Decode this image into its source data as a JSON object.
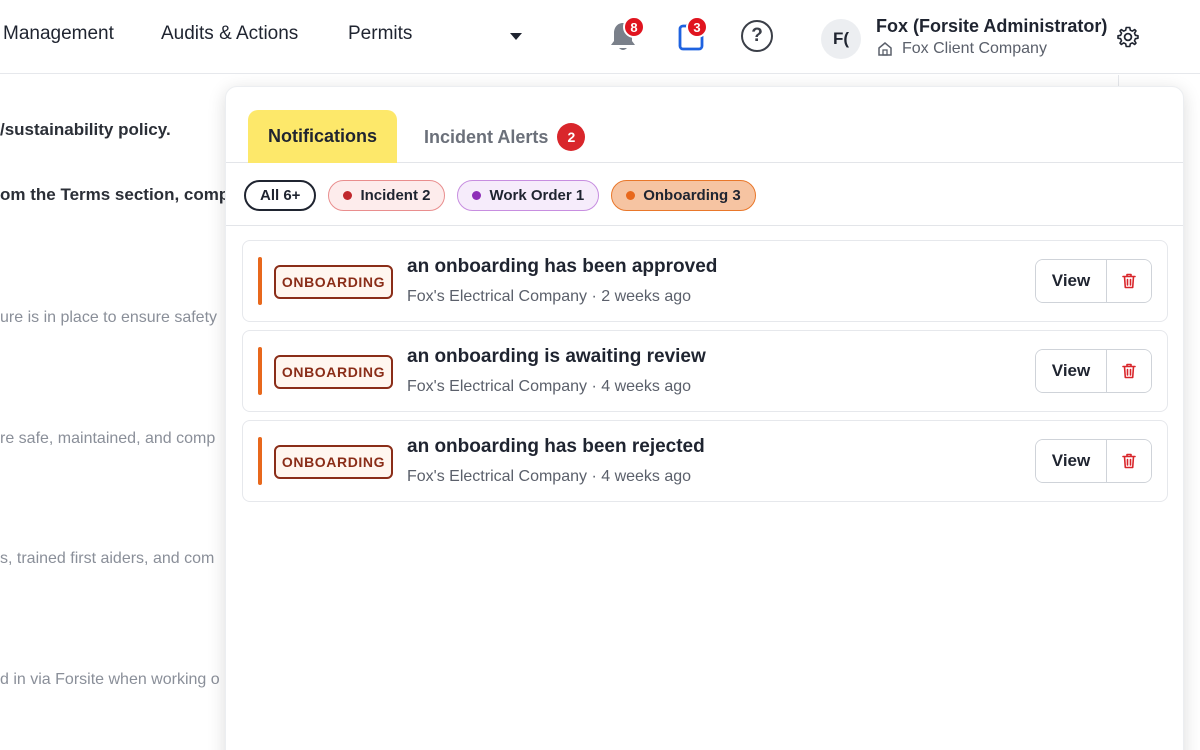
{
  "nav": {
    "items": [
      "Management",
      "Audits & Actions",
      "Permits"
    ],
    "notification_count": "8",
    "tasks_count": "3",
    "help_symbol": "?",
    "user": {
      "initials": "F(",
      "name": "Fox (Forsite Administrator)",
      "company": "Fox Client Company"
    }
  },
  "background": {
    "lines": [
      "/sustainability policy.",
      "om the Terms section, compl",
      "ure is in place to ensure safety",
      "re safe, maintained, and comp",
      "s, trained first aiders, and com",
      "d in via Forsite when working o"
    ]
  },
  "panel": {
    "tabs": {
      "notifications": "Notifications",
      "incident_alerts": "Incident Alerts",
      "incident_alerts_count": "2"
    },
    "filters": [
      {
        "label": "All 6+"
      },
      {
        "label": "Incident 2",
        "dot_color": "#c0282d"
      },
      {
        "label": "Work Order 1",
        "dot_color": "#8e2fb8"
      },
      {
        "label": "Onboarding 3",
        "dot_color": "#e8681c"
      }
    ],
    "items": [
      {
        "tag": "ONBOARDING",
        "title": "an onboarding has been approved",
        "meta": "Fox's Electrical Company · 2 weeks ago",
        "view_label": "View"
      },
      {
        "tag": "ONBOARDING",
        "title": "an onboarding is awaiting review",
        "meta": "Fox's Electrical Company · 4 weeks ago",
        "view_label": "View"
      },
      {
        "tag": "ONBOARDING",
        "title": "an onboarding has been rejected",
        "meta": "Fox's Electrical Company · 4 weeks ago",
        "view_label": "View"
      }
    ]
  },
  "colors": {
    "accent_yellow": "#fde86a",
    "onboarding_orange": "#e8681c",
    "badge_red": "#e0141f"
  },
  "icons": {
    "bell": "bell-icon",
    "tasks": "clipboard-icon",
    "help": "help-icon",
    "home": "home-icon",
    "settings": "gear-icon",
    "delete": "trash-icon",
    "dropdown": "chevron-down-icon"
  }
}
